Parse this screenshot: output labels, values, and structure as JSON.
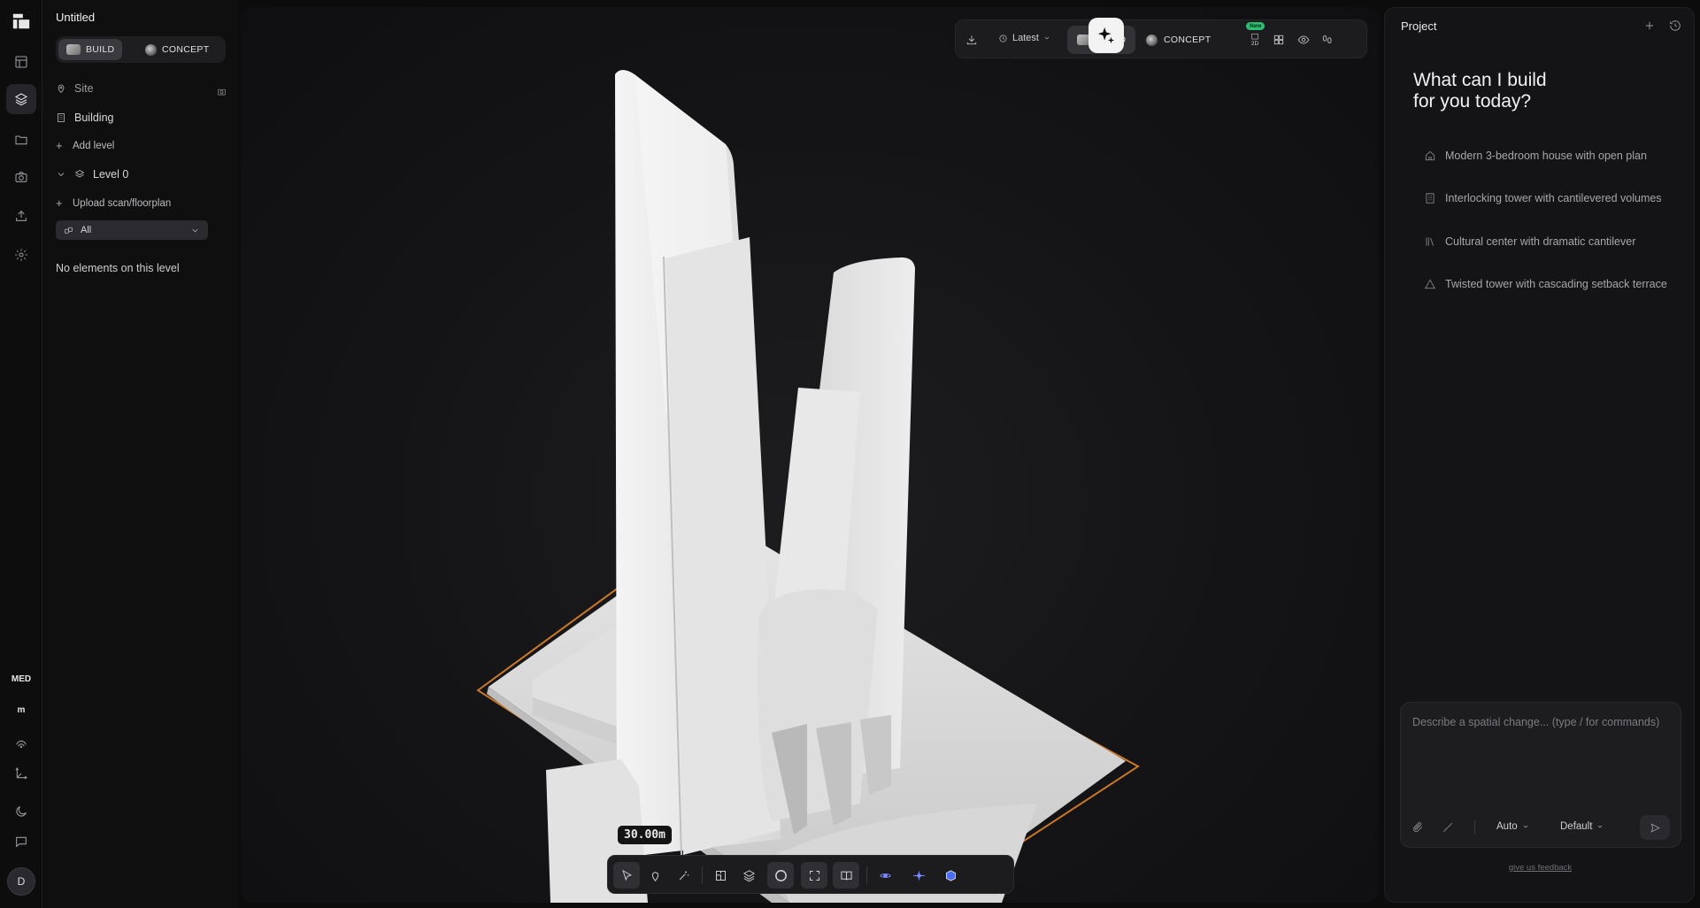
{
  "project": {
    "name": "Untitled"
  },
  "modes": {
    "build": "BUILD",
    "concept": "CONCEPT"
  },
  "tree": {
    "site": "Site",
    "building": "Building",
    "add_level": "Add level",
    "level": "Level 0",
    "upload": "Upload scan/floorplan",
    "filter_value": "All",
    "empty_message": "No elements on this level"
  },
  "rail": {
    "quality": "MED",
    "units": "m",
    "avatar": "D"
  },
  "viewport": {
    "dimension_label": "30.00m"
  },
  "topbar": {
    "version": "Latest",
    "badge": "New",
    "view2d": "2D"
  },
  "panel": {
    "title": "Project",
    "heading_line1": "What can I build",
    "heading_line2": "for you today?",
    "suggestions": [
      {
        "icon": "house-icon",
        "text": "Modern 3-bedroom house with open plan"
      },
      {
        "icon": "building-icon",
        "text": "Interlocking tower with cantilevered volumes"
      },
      {
        "icon": "library-icon",
        "text": "Cultural center with dramatic cantilever"
      },
      {
        "icon": "triangle-icon",
        "text": "Twisted tower with cascading setback terrace"
      }
    ],
    "composer_placeholder": "Describe a spatial change... (type / for commands)",
    "model_select": "Auto",
    "style_select": "Default",
    "feedback": "give us feedback"
  },
  "colors": {
    "accent_orange": "#c9782a",
    "model_white": "#e9e9e9",
    "badge_green": "#2fbf71"
  }
}
